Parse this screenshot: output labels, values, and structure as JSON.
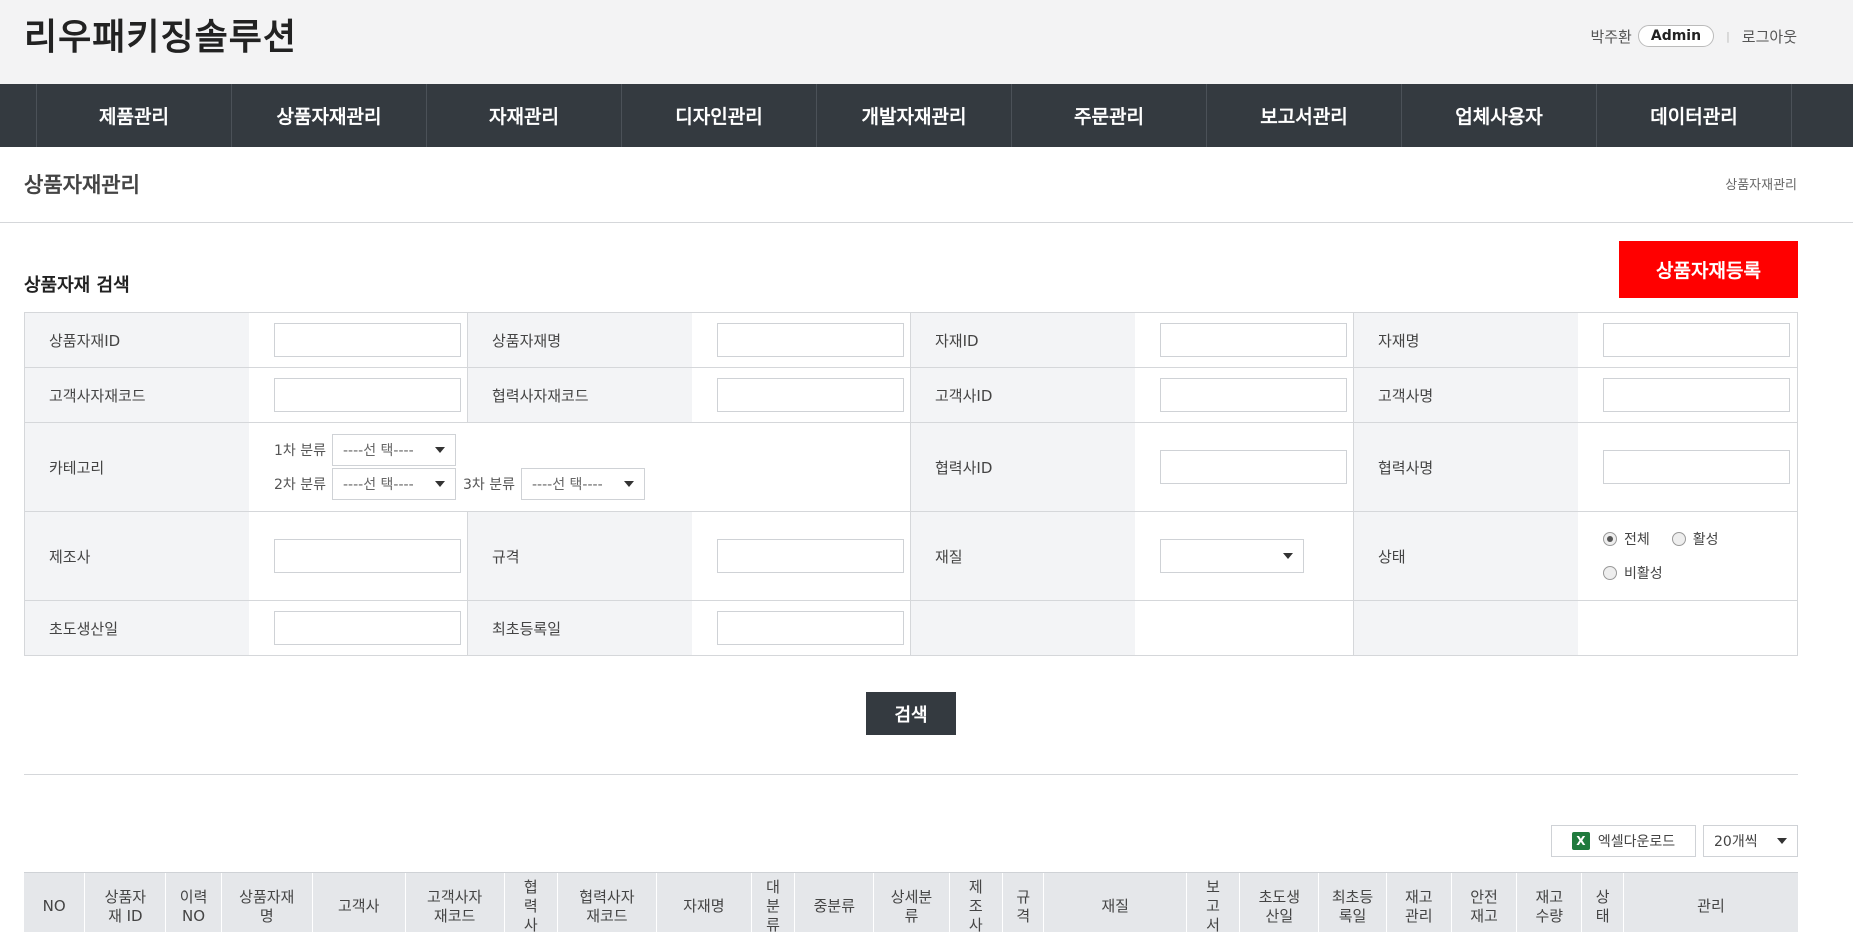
{
  "header": {
    "logo": "리우패키징솔루션",
    "user_name": "박주환",
    "role": "Admin",
    "separator": "|",
    "logout": "로그아웃"
  },
  "nav": {
    "items": [
      "제품관리",
      "상품자재관리",
      "자재관리",
      "디자인관리",
      "개발자재관리",
      "주문관리",
      "보고서관리",
      "업체사용자",
      "데이터관리"
    ]
  },
  "page": {
    "title": "상품자재관리",
    "breadcrumb": "상품자재관리"
  },
  "search": {
    "section_title": "상품자재 검색",
    "register_button": "상품자재등록",
    "labels": {
      "product_material_id": "상품자재ID",
      "product_material_name": "상품자재명",
      "material_id": "자재ID",
      "material_name": "자재명",
      "customer_material_code": "고객사자재코드",
      "partner_material_code": "협력사자재코드",
      "customer_id": "고객사ID",
      "customer_name": "고객사명",
      "category": "카테고리",
      "partner_id": "협력사ID",
      "partner_name": "협력사명",
      "manufacturer": "제조사",
      "spec": "규격",
      "material": "재질",
      "status": "상태",
      "first_production_date": "초도생산일",
      "first_registration_date": "최초등록일"
    },
    "category": {
      "level1_label": "1차 분류",
      "level2_label": "2차 분류",
      "level3_label": "3차 분류",
      "select_placeholder": "----선 택----"
    },
    "status_options": {
      "all": "전체",
      "active": "활성",
      "inactive": "비활성"
    },
    "search_button": "검색"
  },
  "results": {
    "excel_button": "엑셀다운로드",
    "excel_icon_letter": "X",
    "per_page": "20개씩",
    "columns": [
      "NO",
      "상품자\n재 ID",
      "이력\nNO",
      "상품자재\n명",
      "고객사",
      "고객사자\n재코드",
      "협\n력\n사",
      "협력사자\n재코드",
      "자재명",
      "대\n분\n류",
      "중분류",
      "상세분\n류",
      "제\n조\n사",
      "규\n격",
      "재질",
      "보\n고\n서",
      "초도생\n산일",
      "최초등\n록일",
      "재고\n관리",
      "안전\n재고",
      "재고\n수량",
      "상\n태",
      "관리"
    ]
  }
}
